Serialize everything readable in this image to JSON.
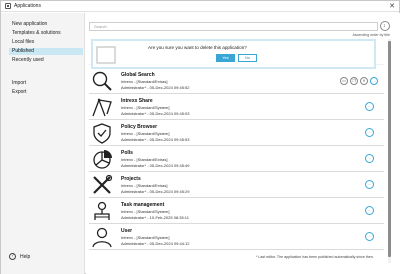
{
  "window": {
    "title": "Applications",
    "close_glyph": "✕"
  },
  "sidebar": {
    "items": [
      {
        "label": "New application"
      },
      {
        "label": "Templates & solutions"
      },
      {
        "label": "Local files"
      },
      {
        "label": "Published"
      },
      {
        "label": "Recently used"
      },
      {
        "label": "Import"
      },
      {
        "label": "Export"
      }
    ],
    "help_label": "Help",
    "help_glyph": "?"
  },
  "search": {
    "placeholder": "Search"
  },
  "sort_label": "Ascending order by title",
  "confirm": {
    "message": "Are you sure you want to delete this application?",
    "yes": "Yes",
    "no": "No"
  },
  "apps": [
    {
      "name": "Global Search",
      "app": "Intrexx - [Standard/Extras]",
      "meta": "Administrator* - 05-Dec-2024 09:45:52",
      "icon": "magnifier-icon"
    },
    {
      "name": "Intrexx Share",
      "app": "Intrexx - [Standard/System]",
      "meta": "Administrator* - 05-Dec-2024 09:45:03",
      "icon": "share-icon"
    },
    {
      "name": "Policy Browser",
      "app": "Intrexx - [Standard/System]",
      "meta": "Administrator* - 05-Dec-2024 09:45:53",
      "icon": "shield-icon"
    },
    {
      "name": "Polls",
      "app": "Intrexx - [Standard/Extras]",
      "meta": "Administrator* - 05-Dec-2024 09:45:49",
      "icon": "pie-chart-icon"
    },
    {
      "name": "Projects",
      "app": "Intrexx - [Standard/Extras]",
      "meta": "Administrator* - 05-Dec-2024 09:45:29",
      "icon": "tools-icon"
    },
    {
      "name": "Task management",
      "app": "Intrexx - [Standard/System]",
      "meta": "Administrator* - 10-Feb-2025 08:35:11",
      "icon": "tasks-icon"
    },
    {
      "name": "User",
      "app": "Intrexx - [Standard/System]",
      "meta": "Administrator* - 05-Dec-2024 09:44:12",
      "icon": "user-icon"
    }
  ],
  "footnote": "* Last editor. The application has been published automatically since then.",
  "accent": "#3aa6d6"
}
